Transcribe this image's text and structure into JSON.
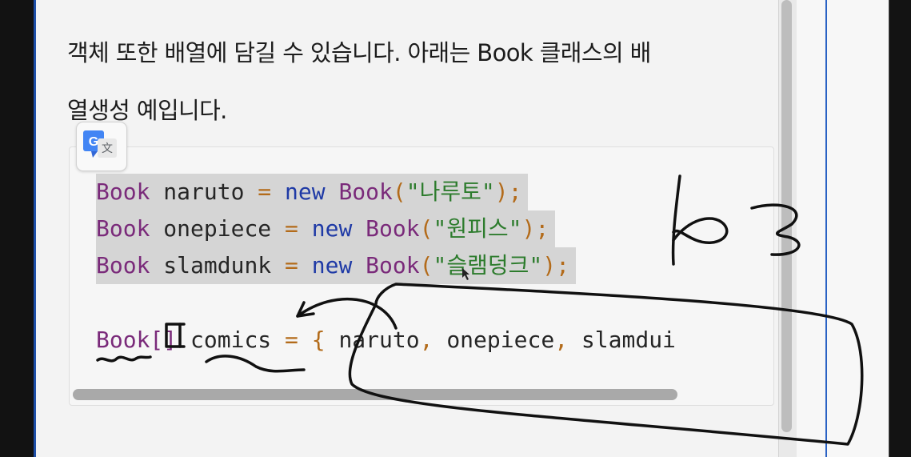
{
  "paragraph": {
    "line1": "객체 또한 배열에 담길 수 있습니다. 아래는 Book 클래스의 배",
    "line2": "열생성 예입니다."
  },
  "translate_button": {
    "icon": "google-translate-icon"
  },
  "code": {
    "lines": [
      {
        "type": "Book",
        "var": " naruto ",
        "eq": "=",
        "kw": " new ",
        "ctor": "Book",
        "open": "(",
        "str": "\"나루토\"",
        "close": ");"
      },
      {
        "type": "Book",
        "var": " onepiece ",
        "eq": "=",
        "kw": " new ",
        "ctor": "Book",
        "open": "(",
        "str": "\"원피스\"",
        "close": ");"
      },
      {
        "type": "Book",
        "var": " slamdunk ",
        "eq": "=",
        "kw": " new ",
        "ctor": "Book",
        "open": "(",
        "str": "\"슬램덩크\"",
        "close": ");"
      }
    ],
    "array_line": {
      "type": "Book[]",
      "var": " comics ",
      "eq": "=",
      "brace": " {",
      "items": " naruto",
      "comma1": ",",
      "item2": " onepiece",
      "comma2": ",",
      "item3": " slamdui"
    }
  },
  "annotation": {
    "handwritten_note": "x3",
    "ink_color": "#111111"
  },
  "colors": {
    "type": "#7a2a7a",
    "keyword": "#1f3aa6",
    "string": "#2d7c2d",
    "accent_line": "#1e4fa8"
  }
}
